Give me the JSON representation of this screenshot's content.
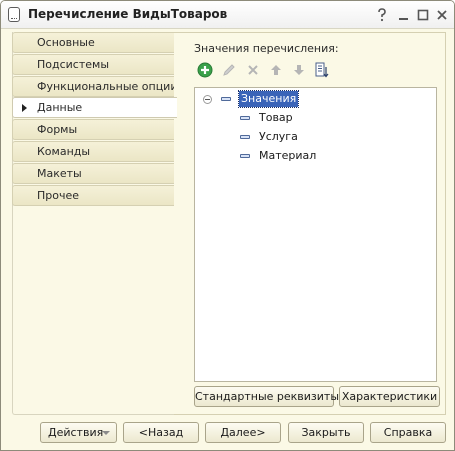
{
  "window": {
    "title": "Перечисление ВидыТоваров"
  },
  "titlebar_buttons": [
    {
      "name": "help-icon",
      "glyph": "?"
    },
    {
      "name": "minimize-icon",
      "glyph": "_"
    },
    {
      "name": "maximize-icon",
      "glyph": "□"
    },
    {
      "name": "close-icon",
      "glyph": "✕"
    }
  ],
  "nav": {
    "items": [
      {
        "label": "Основные"
      },
      {
        "label": "Подсистемы"
      },
      {
        "label": "Функциональные опции"
      },
      {
        "label": "Данные",
        "active": true
      },
      {
        "label": "Формы"
      },
      {
        "label": "Команды"
      },
      {
        "label": "Макеты"
      },
      {
        "label": "Прочее"
      }
    ]
  },
  "main": {
    "values_label": "Значения перечисления:",
    "toolbar": [
      {
        "name": "add-icon",
        "color": "#3aa14a"
      },
      {
        "name": "edit-icon",
        "color": "#b5b5b5"
      },
      {
        "name": "delete-icon",
        "color": "#b5b5b5"
      },
      {
        "name": "move-up-icon",
        "color": "#b5b5b5"
      },
      {
        "name": "move-down-icon",
        "color": "#b5b5b5"
      },
      {
        "name": "sort-icon",
        "color": "#4a5f8a"
      }
    ],
    "tree": {
      "root": "Значения",
      "children": [
        "Товар",
        "Услуга",
        "Материал"
      ]
    },
    "standard_attributes_button": "Стандартные реквизиты",
    "characteristics_button": "Характеристики"
  },
  "footer": {
    "actions": "Действия",
    "back": "<Назад",
    "next": "Далее>",
    "close": "Закрыть",
    "help": "Справка"
  },
  "colors": {
    "window_bg": "#fbf9e6",
    "selection": "#3a64b8",
    "tab_bg": "#ebe6c6"
  }
}
